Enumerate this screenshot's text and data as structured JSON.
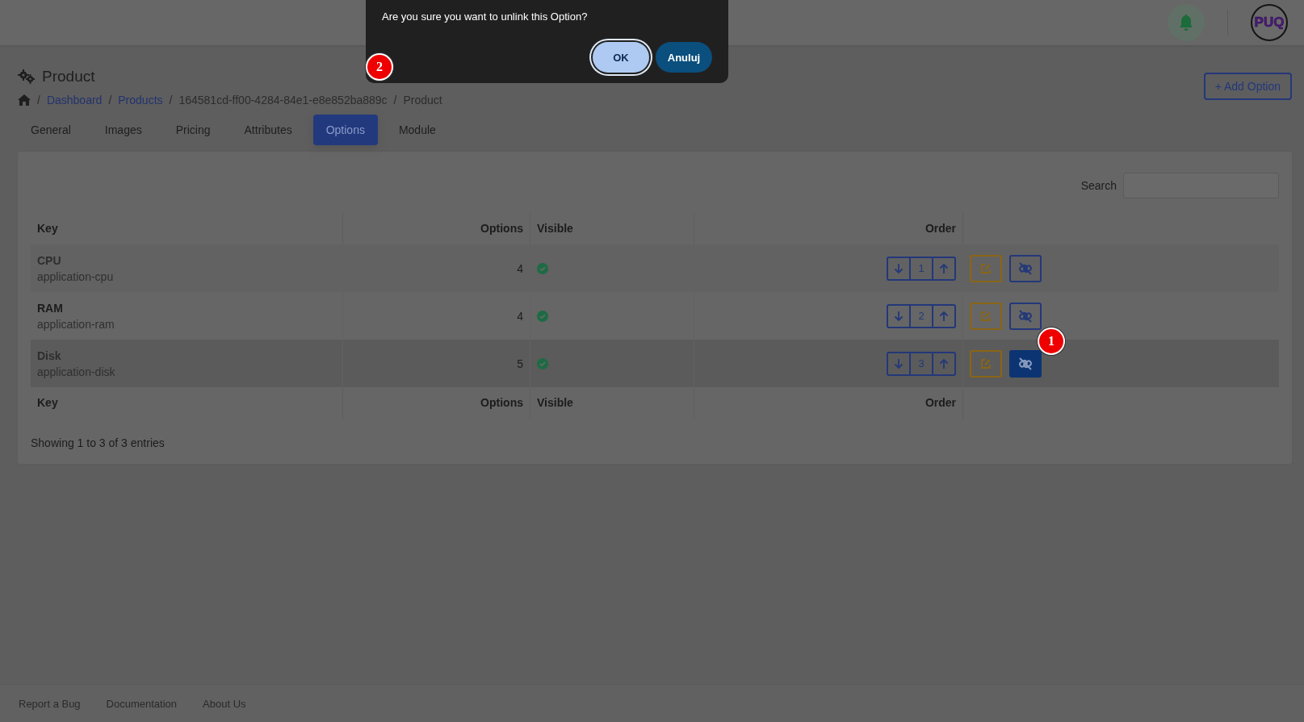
{
  "header": {
    "avatar_text": "PUQ"
  },
  "dialog": {
    "message": "Are you sure you want to unlink this Option?",
    "buttons": [
      {
        "label": "OK",
        "kind": "primary",
        "focused": true
      },
      {
        "label": "Anuluj",
        "kind": "secondary",
        "focused": false
      }
    ]
  },
  "page": {
    "title": "Product",
    "add_button": "+ Add Option"
  },
  "breadcrumb": {
    "separator": "/",
    "items": [
      {
        "label": "Dashboard",
        "kind": "link"
      },
      {
        "label": "Products",
        "kind": "link"
      },
      {
        "label": "164581cd-ff00-4284-84e1-e8e852ba889c",
        "kind": "text"
      },
      {
        "label": "Product",
        "kind": "text"
      }
    ]
  },
  "tabs": [
    {
      "label": "General",
      "selected": false
    },
    {
      "label": "Images",
      "selected": false
    },
    {
      "label": "Pricing",
      "selected": false
    },
    {
      "label": "Attributes",
      "selected": false
    },
    {
      "label": "Options",
      "selected": true
    },
    {
      "label": "Module",
      "selected": false
    }
  ],
  "search": {
    "label": "Search"
  },
  "table": {
    "columns": [
      "Key",
      "Options",
      "Visible",
      "Order"
    ],
    "rows": [
      {
        "name": "CPU",
        "key": "application-cpu",
        "options": "4",
        "visible": true,
        "order": "1",
        "highlighted": false,
        "unlink_active": false
      },
      {
        "name": "RAM",
        "key": "application-ram",
        "options": "4",
        "visible": true,
        "order": "2",
        "highlighted": false,
        "unlink_active": false
      },
      {
        "name": "Disk",
        "key": "application-disk",
        "options": "5",
        "visible": true,
        "order": "3",
        "highlighted": true,
        "unlink_active": true
      }
    ],
    "footer_columns": [
      "Key",
      "Options",
      "Visible",
      "Order"
    ],
    "info": "Showing 1 to 3 of 3 entries"
  },
  "markers": [
    {
      "label": "1"
    },
    {
      "label": "2"
    }
  ],
  "footer": {
    "links": [
      "Report a Bug",
      "Documentation",
      "About Us"
    ]
  }
}
